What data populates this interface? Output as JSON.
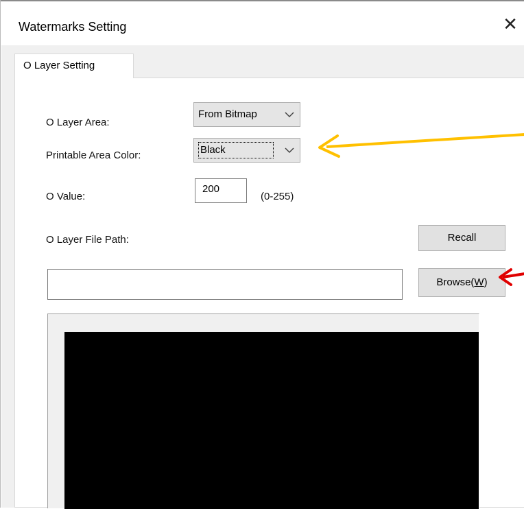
{
  "window": {
    "title": "Watermarks Setting",
    "close_glyph": "✕"
  },
  "tabs": [
    {
      "label": "O Layer Setting",
      "selected": true
    }
  ],
  "form": {
    "o_layer_area": {
      "label": "O Layer Area:",
      "value": "From Bitmap"
    },
    "printable_area_color": {
      "label": "Printable Area Color:",
      "value": "Black"
    },
    "o_value": {
      "label": "O Value:",
      "value": "200",
      "range": "(0-255)"
    },
    "o_layer_file_path": {
      "label": "O Layer File Path:",
      "value": ""
    }
  },
  "buttons": {
    "recall": "Recall",
    "browse_prefix": "Browse(",
    "browse_accel": "W",
    "browse_suffix": ")"
  },
  "preview": {
    "fill_color": "#000000"
  },
  "annotations": [
    {
      "color": "#FFC000",
      "points_to": "printable-area-color-dropdown"
    },
    {
      "color": "#E00000",
      "points_to": "browse-button"
    }
  ],
  "icons": {
    "dropdown": "chevron-down-icon",
    "close": "close-icon"
  }
}
